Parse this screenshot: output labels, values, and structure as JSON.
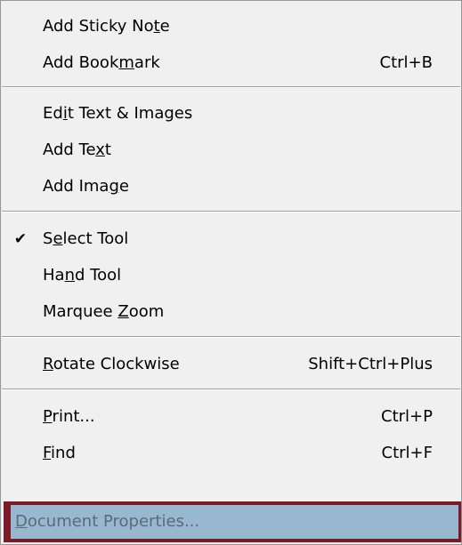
{
  "menu": {
    "items": [
      {
        "pre": "Add Sticky No",
        "u": "t",
        "post": "e",
        "shortcut": ""
      },
      {
        "pre": "Add Book",
        "u": "m",
        "post": "ark",
        "shortcut": "Ctrl+B"
      },
      {
        "pre": "Ed",
        "u": "i",
        "post": "t Text & Images",
        "shortcut": ""
      },
      {
        "pre": "Add Te",
        "u": "x",
        "post": "t",
        "shortcut": ""
      },
      {
        "pre": "Add Ima",
        "u": "g",
        "post": "e",
        "shortcut": ""
      },
      {
        "pre": "S",
        "u": "e",
        "post": "lect Tool",
        "shortcut": "",
        "checked": true
      },
      {
        "pre": "Ha",
        "u": "n",
        "post": "d Tool",
        "shortcut": ""
      },
      {
        "pre": "Marquee ",
        "u": "Z",
        "post": "oom",
        "shortcut": ""
      },
      {
        "pre": "",
        "u": "R",
        "post": "otate Clockwise",
        "shortcut": "Shift+Ctrl+Plus"
      },
      {
        "pre": "",
        "u": "P",
        "post": "rint...",
        "shortcut": "Ctrl+P"
      },
      {
        "pre": "",
        "u": "F",
        "post": "ind",
        "shortcut": "Ctrl+F"
      },
      {
        "pre": "",
        "u": "D",
        "post": "ocument Properties...",
        "shortcut": "",
        "highlighted": true
      }
    ],
    "check_glyph": "✔"
  },
  "colors": {
    "menu_bg": "#f0f0f0",
    "highlight_bg": "#98b8cf",
    "highlight_frame": "#7b1a28",
    "disabled_text": "#5b6a78"
  }
}
